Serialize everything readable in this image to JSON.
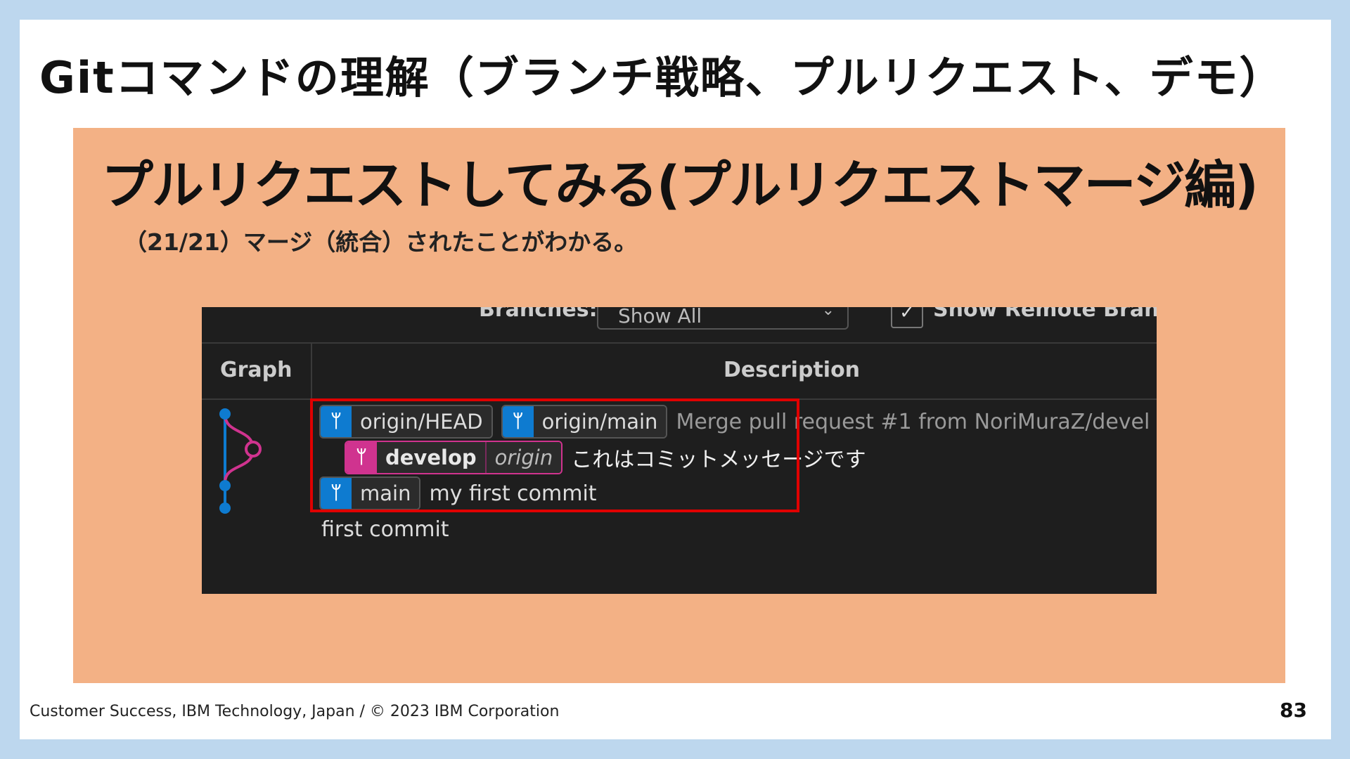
{
  "slide": {
    "title": "Gitコマンドの理解（ブランチ戦略、プルリクエスト、デモ）",
    "heading": "プルリクエストしてみる(プルリクエストマージ編)",
    "subtitle": "（21/21）マージ（統合）されたことがわかる。",
    "footer": "Customer Success, IBM Technology, Japan / © 2023 IBM Corporation",
    "page_number": "83"
  },
  "git_graph": {
    "toolbar": {
      "branches_label": "Branches:",
      "branches_value": "Show All",
      "remote_checked": true,
      "remote_label": "Show Remote Branc"
    },
    "columns": {
      "graph": "Graph",
      "description": "Description"
    },
    "rows": [
      {
        "tags": [
          "origin/HEAD",
          "origin/main"
        ],
        "message": "Merge pull request #1 from NoriMuraZ/devel"
      },
      {
        "branch": "develop",
        "remote": "origin",
        "message": "これはコミットメッセージです"
      },
      {
        "tags": [
          "main"
        ],
        "message": "my first commit"
      },
      {
        "message": "first commit"
      }
    ],
    "colors": {
      "main_branch": "#0e7bd0",
      "develop_branch": "#d0338f",
      "highlight_box": "#e00000"
    }
  }
}
